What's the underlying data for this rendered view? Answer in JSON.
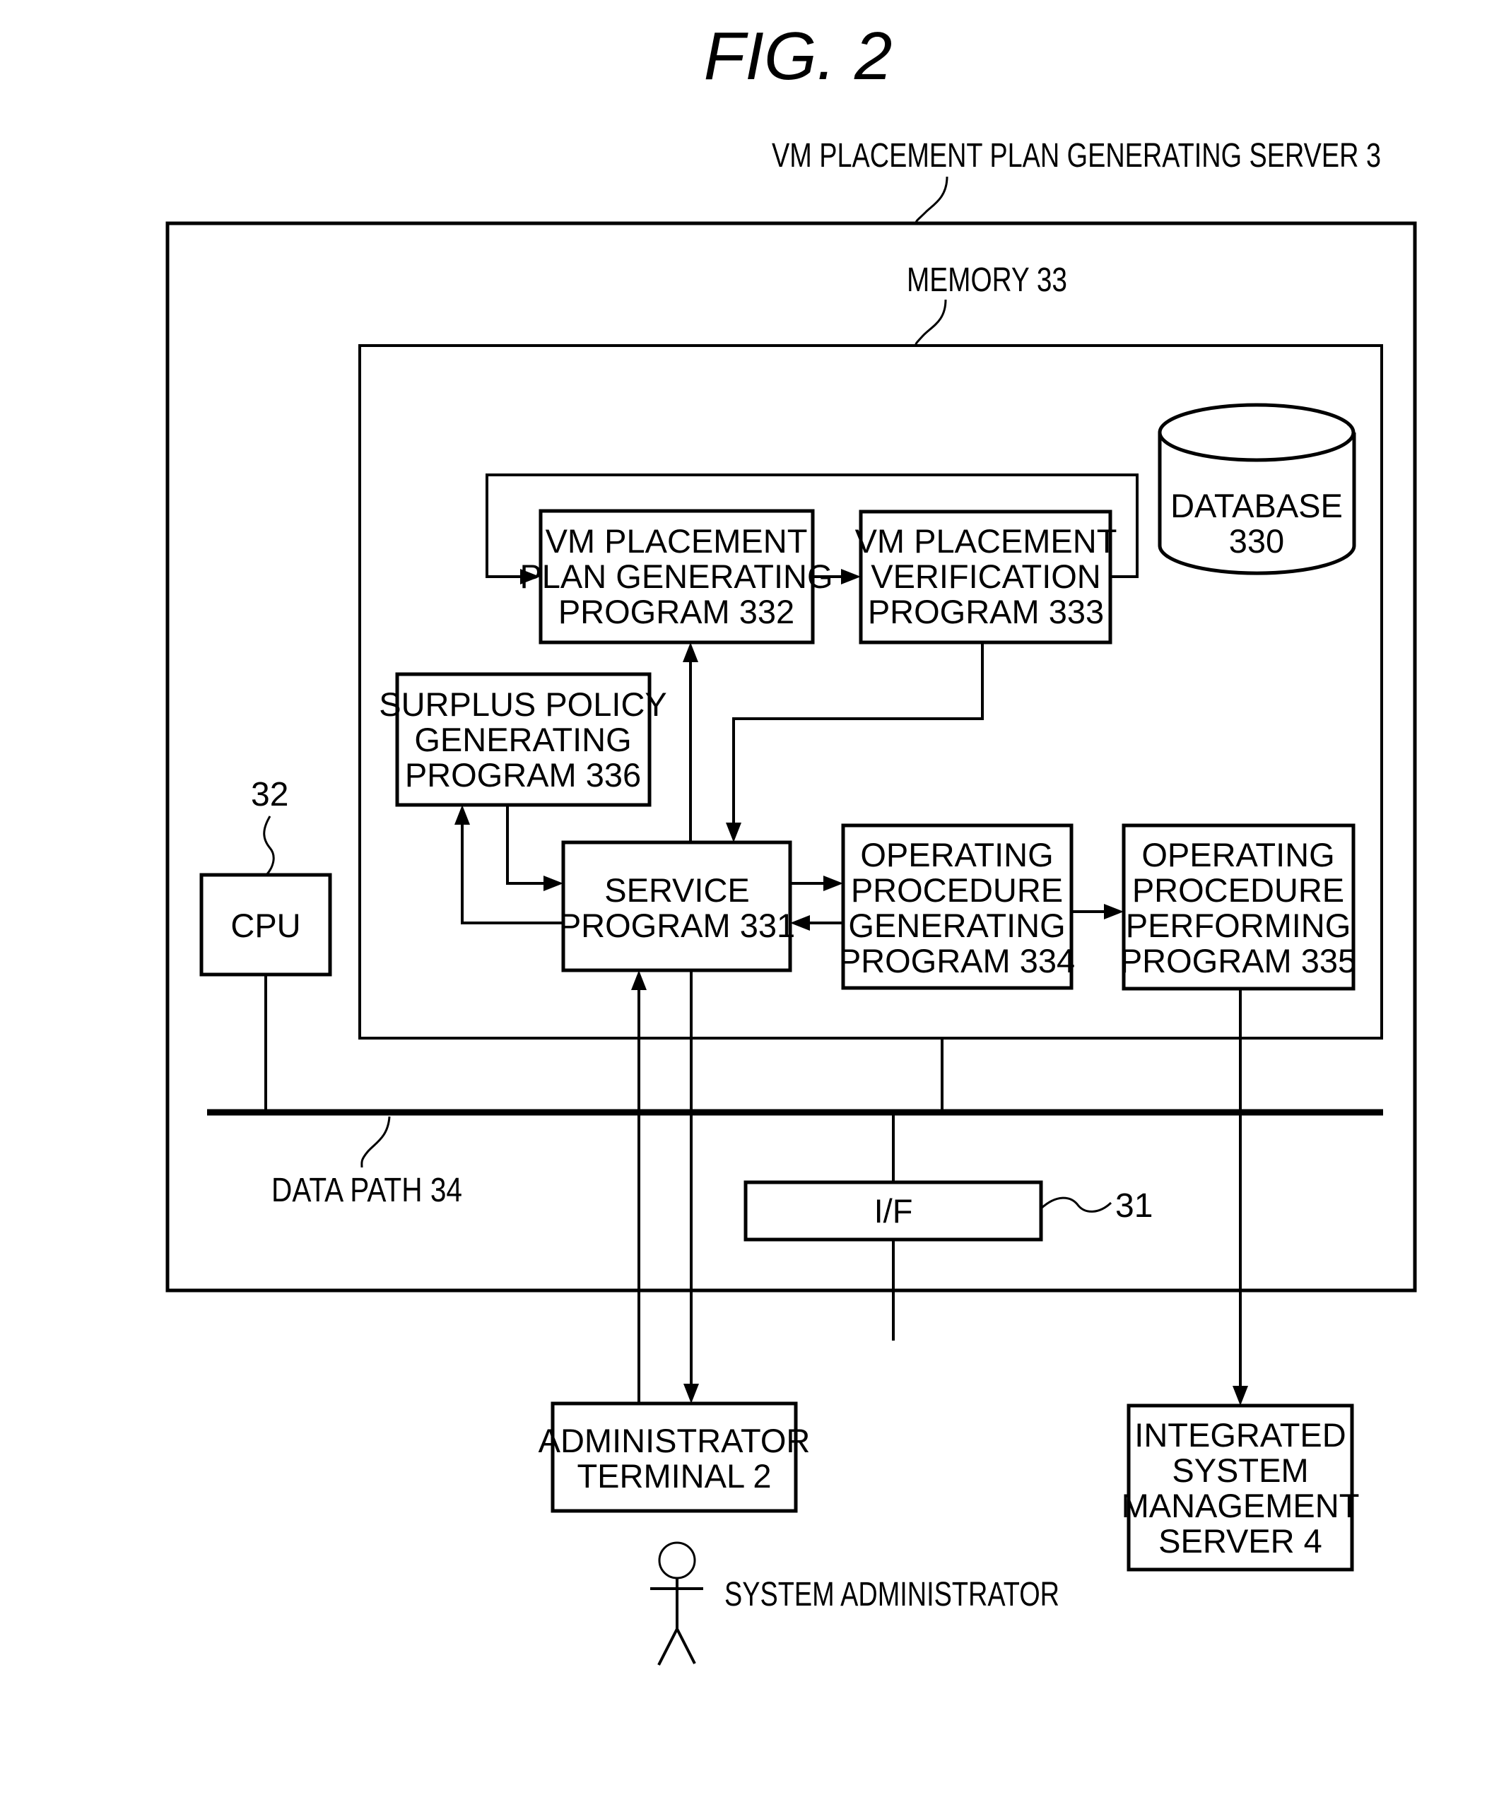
{
  "figure": {
    "title": "FIG.  2"
  },
  "labels": {
    "server": "VM PLACEMENT PLAN GENERATING SERVER 3",
    "memory": "MEMORY 33",
    "cpu_ref": "32",
    "data_path": "DATA PATH 34",
    "if_ref": "31",
    "system_admin": "SYSTEM ADMINISTRATOR"
  },
  "blocks": {
    "database": [
      "DATABASE",
      "330"
    ],
    "vm_plan_gen": [
      "VM PLACEMENT",
      "PLAN GENERATING",
      "PROGRAM 332"
    ],
    "vm_verify": [
      "VM PLACEMENT",
      "VERIFICATION",
      "PROGRAM 333"
    ],
    "surplus_policy": [
      "SURPLUS POLICY",
      "GENERATING",
      "PROGRAM 336"
    ],
    "service": [
      "SERVICE",
      "PROGRAM 331"
    ],
    "op_proc_gen": [
      "OPERATING",
      "PROCEDURE",
      "GENERATING",
      "PROGRAM 334"
    ],
    "op_proc_perf": [
      "OPERATING",
      "PROCEDURE",
      "PERFORMING",
      "PROGRAM 335"
    ],
    "cpu": [
      "CPU"
    ],
    "interface": [
      "I/F"
    ],
    "admin_terminal": [
      "ADMINISTRATOR",
      "TERMINAL 2"
    ],
    "ism_server": [
      "INTEGRATED",
      "SYSTEM",
      "MANAGEMENT",
      "SERVER 4"
    ]
  },
  "icons": {
    "actor": "stick-figure-person"
  }
}
